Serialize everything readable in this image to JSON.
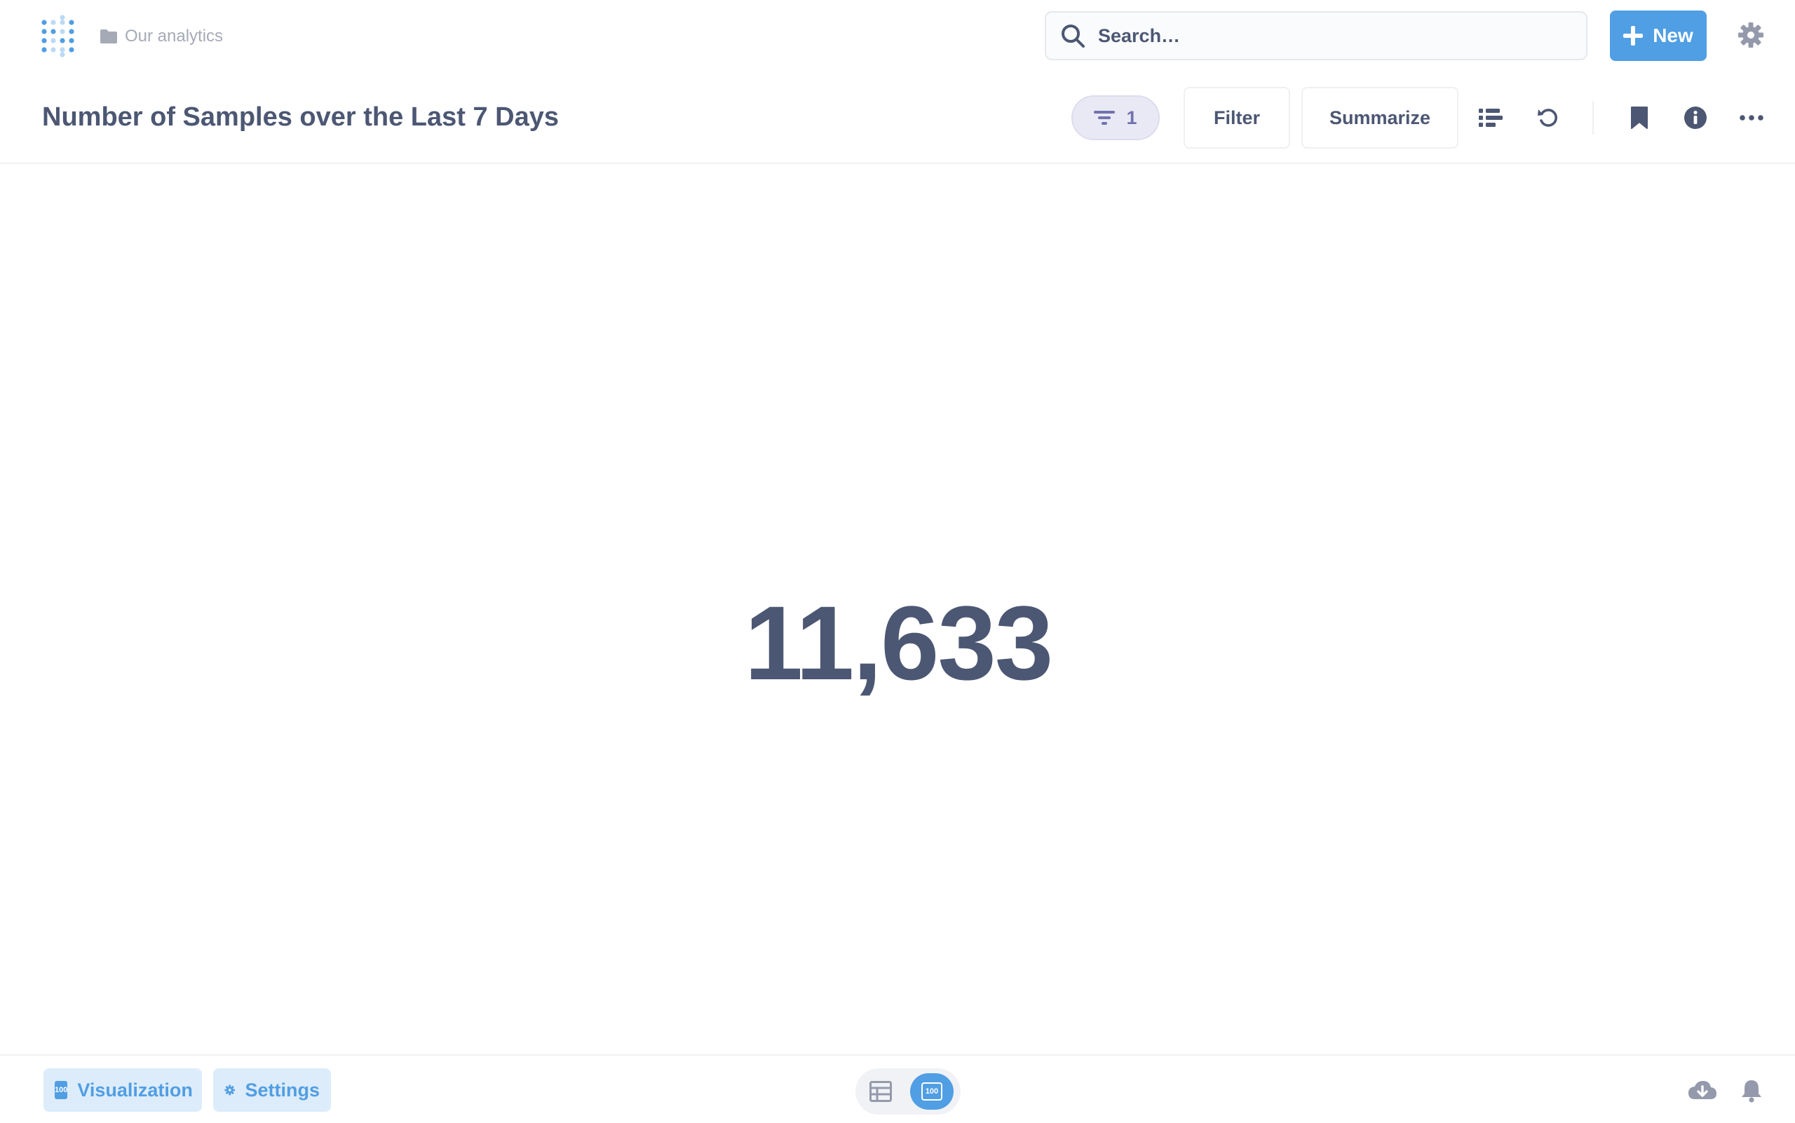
{
  "nav": {
    "breadcrumb": "Our analytics",
    "search_placeholder": "Search…",
    "new_label": "New"
  },
  "header": {
    "title": "Number of Samples over the Last 7 Days",
    "filter_count": "1",
    "filter_label": "Filter",
    "summarize_label": "Summarize"
  },
  "main": {
    "scalar_value": "11,633"
  },
  "footer": {
    "visualization_label": "Visualization",
    "settings_label": "Settings",
    "viz_badge": "100"
  },
  "colors": {
    "brand": "#509ee3",
    "text": "#4c5773",
    "muted": "#a5aab6",
    "filter_pill": "#7172ad"
  },
  "icons": [
    "metabase-logo-icon",
    "folder-icon",
    "search-icon",
    "plus-icon",
    "gear-icon",
    "filter-icon",
    "notebook-icon",
    "refresh-icon",
    "bookmark-icon",
    "info-icon",
    "ellipsis-icon",
    "table-icon",
    "number-viz-icon",
    "download-icon",
    "bell-icon"
  ]
}
